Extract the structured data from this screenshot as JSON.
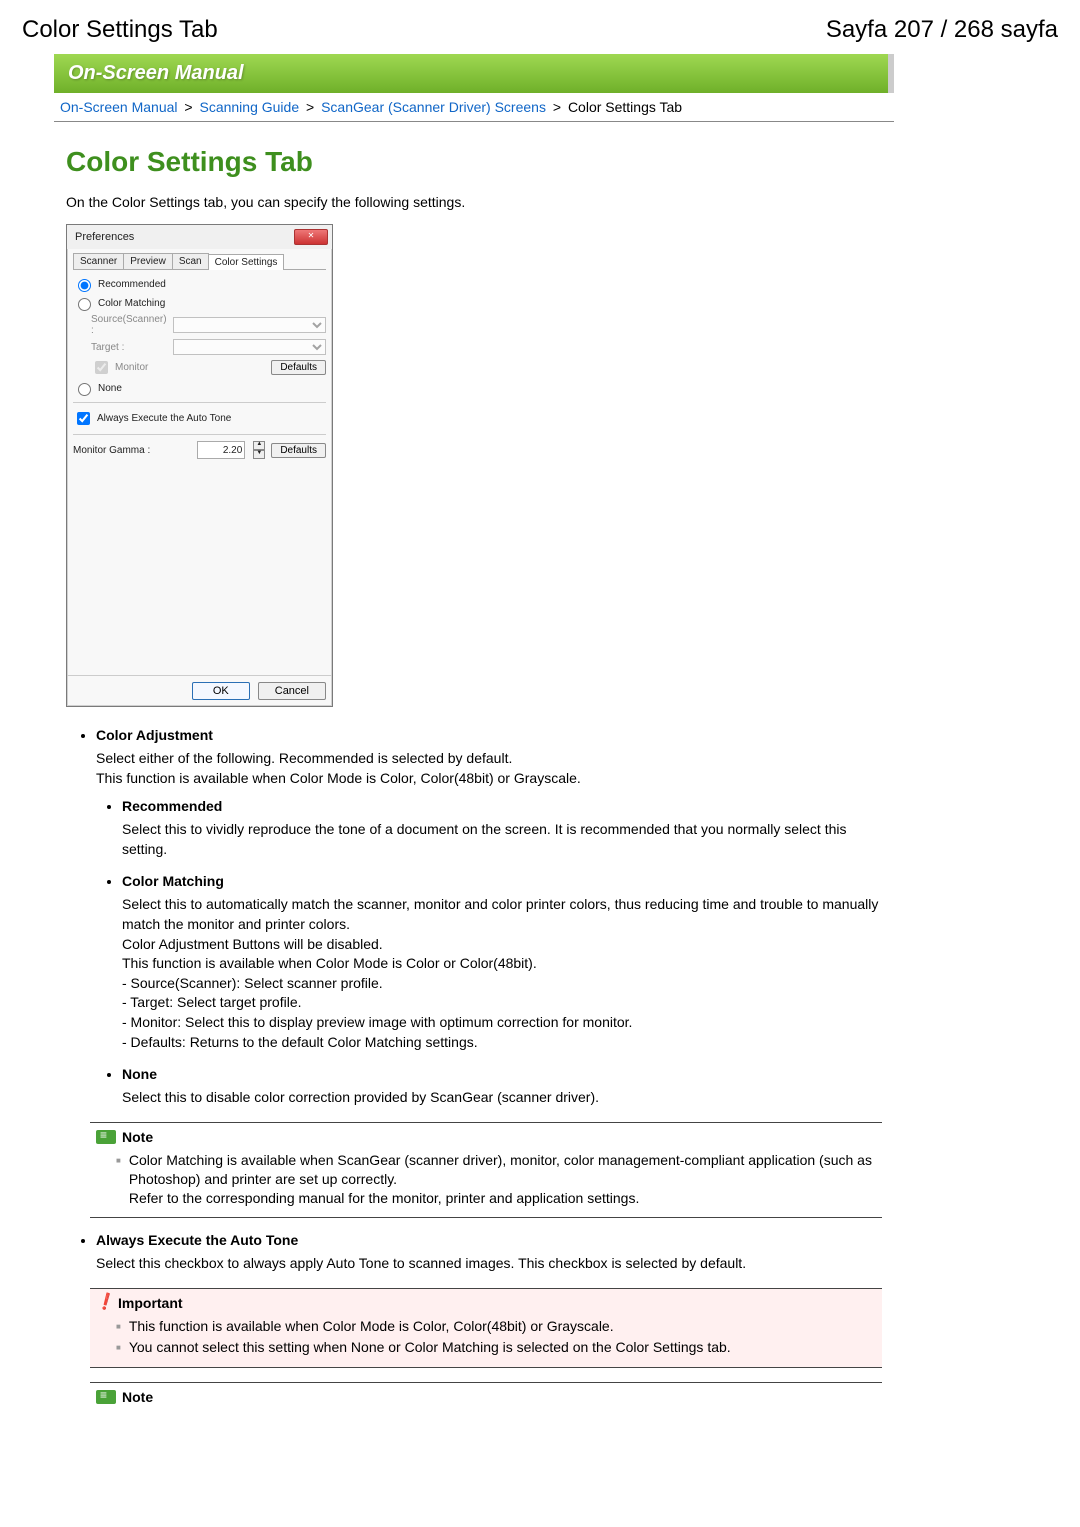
{
  "header": {
    "left": "Color Settings Tab",
    "right": "Sayfa 207 / 268 sayfa"
  },
  "banner": "On-Screen Manual",
  "breadcrumb": {
    "items": [
      "On-Screen Manual",
      "Scanning Guide",
      "ScanGear (Scanner Driver) Screens"
    ],
    "current": "Color Settings Tab",
    "sep": ">"
  },
  "title": "Color Settings Tab",
  "intro": "On the Color Settings tab, you can specify the following settings.",
  "dialog": {
    "title": "Preferences",
    "tabs": [
      "Scanner",
      "Preview",
      "Scan",
      "Color Settings"
    ],
    "active_tab": 3,
    "radio_recommended": "Recommended",
    "radio_color_matching": "Color Matching",
    "source_label": "Source(Scanner) :",
    "target_label": "Target :",
    "monitor_label": "Monitor",
    "defaults_btn": "Defaults",
    "radio_none": "None",
    "auto_tone_label": "Always Execute the Auto Tone",
    "gamma_label": "Monitor Gamma :",
    "gamma_value": "2.20",
    "ok_btn": "OK",
    "cancel_btn": "Cancel"
  },
  "sections": {
    "color_adjustment": {
      "title": "Color Adjustment",
      "desc1": "Select either of the following. Recommended is selected by default.",
      "desc2": "This function is available when Color Mode is Color, Color(48bit) or Grayscale.",
      "recommended": {
        "title": "Recommended",
        "desc": "Select this to vividly reproduce the tone of a document on the screen. It is recommended that you normally select this setting."
      },
      "color_matching": {
        "title": "Color Matching",
        "l1": "Select this to automatically match the scanner, monitor and color printer colors, thus reducing time and trouble to manually match the monitor and printer colors.",
        "l2": "Color Adjustment Buttons will be disabled.",
        "l3": "This function is available when Color Mode is Color or Color(48bit).",
        "l4": "- Source(Scanner): Select scanner profile.",
        "l5": "- Target: Select target profile.",
        "l6": "- Monitor: Select this to display preview image with optimum correction for monitor.",
        "l7": "- Defaults: Returns to the default Color Matching settings."
      },
      "none": {
        "title": "None",
        "desc": "Select this to disable color correction provided by ScanGear (scanner driver)."
      }
    },
    "note1": {
      "title": "Note",
      "l1": "Color Matching is available when ScanGear (scanner driver), monitor, color management-compliant application (such as Photoshop) and printer are set up correctly.",
      "l2": "Refer to the corresponding manual for the monitor, printer and application settings."
    },
    "auto_tone": {
      "title": "Always Execute the Auto Tone",
      "desc": "Select this checkbox to always apply Auto Tone to scanned images. This checkbox is selected by default."
    },
    "important": {
      "title": "Important",
      "l1": "This function is available when Color Mode is Color, Color(48bit) or Grayscale.",
      "l2": "You cannot select this setting when None or Color Matching is selected on the Color Settings tab."
    },
    "note2": {
      "title": "Note"
    }
  }
}
